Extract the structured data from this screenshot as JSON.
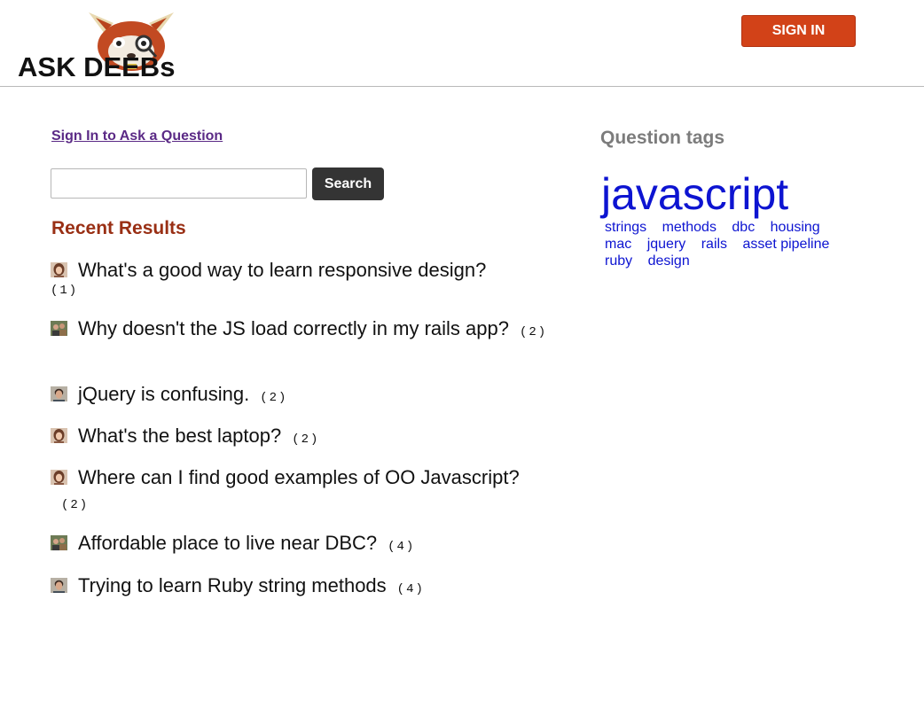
{
  "header": {
    "logo_text": "ASK DEEBs",
    "sign_in_label": "SIGN IN"
  },
  "main": {
    "ask_link": "Sign In to Ask a Question",
    "search": {
      "value": "",
      "placeholder": "",
      "button_label": "Search"
    },
    "recent_heading": "Recent Results",
    "results": [
      {
        "avatar": "avatar-woman",
        "title": "What's a good way to learn responsive design?",
        "count": "(1)"
      },
      {
        "avatar": "avatar-group",
        "title": "Why doesn't the JS load correctly in my rails app?",
        "count": "(2)"
      },
      {
        "avatar": "avatar-man",
        "title": "jQuery is confusing.",
        "count": "(2)"
      },
      {
        "avatar": "avatar-woman",
        "title": "What's the best laptop?",
        "count": "(2)"
      },
      {
        "avatar": "avatar-woman",
        "title": "Where can I find good examples of OO Javascript?",
        "count": "(2)"
      },
      {
        "avatar": "avatar-group",
        "title": "Affordable place to live near DBC?",
        "count": "(4)"
      },
      {
        "avatar": "avatar-man",
        "title": "Trying to learn Ruby string methods",
        "count": "(4)"
      }
    ]
  },
  "sidebar": {
    "tags_heading": "Question tags",
    "featured_tag": "javascript",
    "tags": [
      "strings",
      "methods",
      "dbc",
      "housing",
      "mac",
      "jquery",
      "rails",
      "asset pipeline",
      "ruby",
      "design"
    ]
  },
  "colors": {
    "sign_in_bg": "#d24218",
    "recent_heading": "#992f14",
    "link": "#5b2a86",
    "tag": "#0d14d1"
  }
}
